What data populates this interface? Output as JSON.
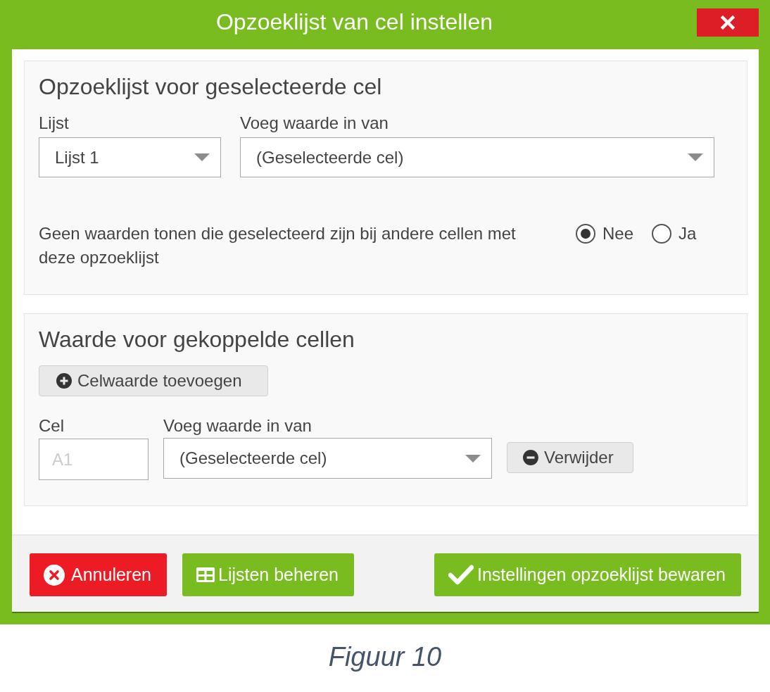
{
  "dialog": {
    "title": "Opzoeklijst van cel instellen"
  },
  "lookup_section": {
    "title": "Opzoeklijst voor geselecteerde cel",
    "fields": [
      {
        "label": "Lijst",
        "value": "Lijst 1"
      },
      {
        "label": "Voeg waarde in van",
        "value": "(Geselecteerde cel)"
      }
    ],
    "option": {
      "text": "Geen waarden tonen die geselecteerd zijn bij andere cellen met deze opzoeklijst",
      "choices": [
        {
          "label": "Nee",
          "selected": true
        },
        {
          "label": "Ja",
          "selected": false
        }
      ]
    }
  },
  "linked_section": {
    "title": "Waarde voor gekoppelde cellen",
    "add_button": "Celwaarde toevoegen",
    "rows": [
      {
        "cell_label": "Cel",
        "cell_placeholder": "A1",
        "source_label": "Voeg waarde in van",
        "source_value": "(Geselecteerde cel)",
        "remove_button": "Verwijder"
      }
    ]
  },
  "footer": {
    "buttons": [
      {
        "label": "Annuleren",
        "kind": "cancel"
      },
      {
        "label": "Lijsten beheren",
        "kind": "manage"
      },
      {
        "label": "Instellingen opzoeklijst bewaren",
        "kind": "save"
      }
    ]
  },
  "caption": "Figuur 10"
}
